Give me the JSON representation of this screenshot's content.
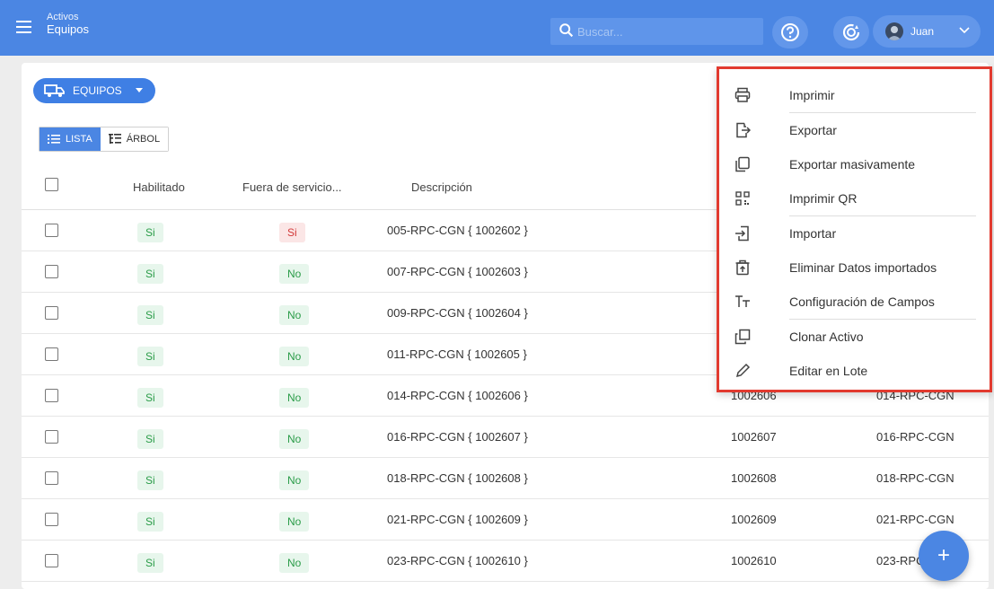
{
  "header": {
    "breadcrumb_parent": "Activos",
    "breadcrumb_current": "Equipos",
    "search_placeholder": "Buscar...",
    "user_name": "Juan"
  },
  "toolbar": {
    "equipos_label": "EQUIPOS",
    "view_list_label": "LISTA",
    "view_tree_label": "ÁRBOL"
  },
  "table": {
    "headers": [
      "Habilitado",
      "Fuera de servicio...",
      "Descripción"
    ],
    "rows": [
      {
        "habilitado": "Si",
        "fuera": "Si",
        "desc": "005-RPC-CGN { 1002602 }",
        "code": "",
        "name": ""
      },
      {
        "habilitado": "Si",
        "fuera": "No",
        "desc": "007-RPC-CGN { 1002603 }",
        "code": "",
        "name": ""
      },
      {
        "habilitado": "Si",
        "fuera": "No",
        "desc": "009-RPC-CGN { 1002604 }",
        "code": "",
        "name": ""
      },
      {
        "habilitado": "Si",
        "fuera": "No",
        "desc": "011-RPC-CGN { 1002605 }",
        "code": "",
        "name": ""
      },
      {
        "habilitado": "Si",
        "fuera": "No",
        "desc": "014-RPC-CGN { 1002606 }",
        "code": "1002606",
        "name": "014-RPC-CGN"
      },
      {
        "habilitado": "Si",
        "fuera": "No",
        "desc": "016-RPC-CGN { 1002607 }",
        "code": "1002607",
        "name": "016-RPC-CGN"
      },
      {
        "habilitado": "Si",
        "fuera": "No",
        "desc": "018-RPC-CGN { 1002608 }",
        "code": "1002608",
        "name": "018-RPC-CGN"
      },
      {
        "habilitado": "Si",
        "fuera": "No",
        "desc": "021-RPC-CGN { 1002609 }",
        "code": "1002609",
        "name": "021-RPC-CGN"
      },
      {
        "habilitado": "Si",
        "fuera": "No",
        "desc": "023-RPC-CGN { 1002610 }",
        "code": "1002610",
        "name": "023-RPC"
      }
    ]
  },
  "menu": {
    "items": [
      {
        "label": "Imprimir",
        "icon": "printer-icon"
      },
      {
        "label": "Exportar",
        "icon": "export-icon"
      },
      {
        "label": "Exportar masivamente",
        "icon": "bulk-export-icon"
      },
      {
        "label": "Imprimir QR",
        "icon": "qr-icon"
      },
      {
        "label": "Importar",
        "icon": "import-icon"
      },
      {
        "label": "Eliminar Datos importados",
        "icon": "delete-import-icon"
      },
      {
        "label": "Configuración de Campos",
        "icon": "text-fields-icon"
      },
      {
        "label": "Clonar Activo",
        "icon": "clone-icon"
      },
      {
        "label": "Editar en Lote",
        "icon": "pencil-icon"
      }
    ]
  },
  "fab_label": "+",
  "colors": {
    "primary": "#4b86e3",
    "highlight_border": "#e23a2f",
    "badge_green": "#2a9c48",
    "badge_red": "#d33a3a"
  }
}
